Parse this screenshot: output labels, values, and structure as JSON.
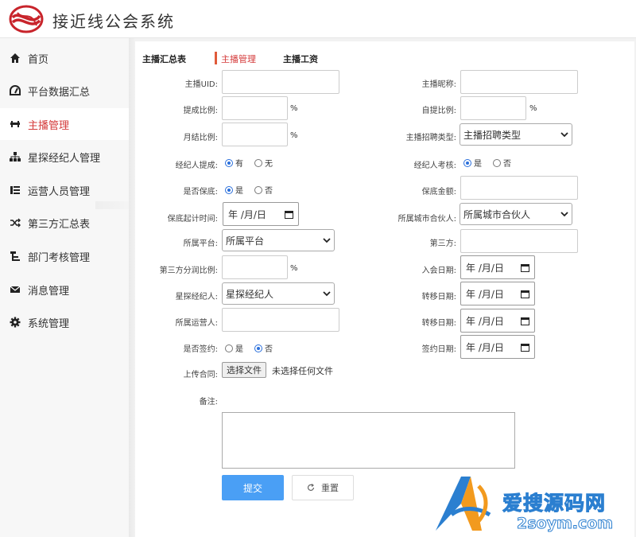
{
  "app": {
    "title": "接近线公会系统"
  },
  "sidebar": {
    "items": [
      {
        "label": "首页",
        "icon": "home-icon"
      },
      {
        "label": "平台数据汇总",
        "icon": "dashboard-icon"
      },
      {
        "label": "主播管理",
        "icon": "anchor-icon",
        "active": true
      },
      {
        "label": "星探经纪人管理",
        "icon": "sitemap-icon"
      },
      {
        "label": "运营人员管理",
        "icon": "list-icon"
      },
      {
        "label": "第三方汇总表",
        "icon": "shuffle-icon"
      },
      {
        "label": "部门考核管理",
        "icon": "hierarchy-icon"
      },
      {
        "label": "消息管理",
        "icon": "envelope-icon"
      },
      {
        "label": "系统管理",
        "icon": "gear-icon"
      }
    ]
  },
  "tabs": [
    {
      "label": "主播汇总表"
    },
    {
      "label": "主播管理",
      "active": true
    },
    {
      "label": "主播工资"
    }
  ],
  "form": {
    "uid_label": "主播UID:",
    "nickname_label": "主播昵称:",
    "commission_label": "提成比例:",
    "self_commission_label": "自提比例:",
    "monthly_label": "月结比例:",
    "recruit_type_label": "主播招聘类型:",
    "recruit_type_value": "主播招聘类型",
    "agent_commission_label": "经纪人提成:",
    "agent_assess_label": "经纪人考核:",
    "guarantee_label": "是否保底:",
    "guarantee_amount_label": "保底金额:",
    "guarantee_start_label": "保底起计时间:",
    "city_partner_label": "所属城市合伙人:",
    "city_partner_value": "所属城市合伙人",
    "platform_label": "所属平台:",
    "platform_value": "所属平台",
    "third_party_label": "第三方:",
    "third_split_label": "第三方分润比例:",
    "join_date_label": "入会日期:",
    "scout_label": "星探经纪人:",
    "scout_value": "星探经纪人",
    "transfer_date_label": "转移日期:",
    "operator_label": "所属运营人:",
    "transfer_date2_label": "转移日期:",
    "signed_label": "是否签约:",
    "sign_date_label": "签约日期:",
    "upload_label": "上传合同:",
    "file_button": "选择文件",
    "file_status": "未选择任何文件",
    "remark_label": "备注:",
    "percent": "%",
    "date_placeholder": "年 /月/日",
    "opt_have": "有",
    "opt_none": "无",
    "opt_yes": "是",
    "opt_no": "否",
    "submit": "提交",
    "reset": "重置"
  },
  "watermark": {
    "line1": "爱搜源码网",
    "line2": "2soym.com"
  },
  "colors": {
    "accent": "#d43a3a",
    "primary": "#4a9ff5",
    "radio": "#2a6fdb"
  }
}
